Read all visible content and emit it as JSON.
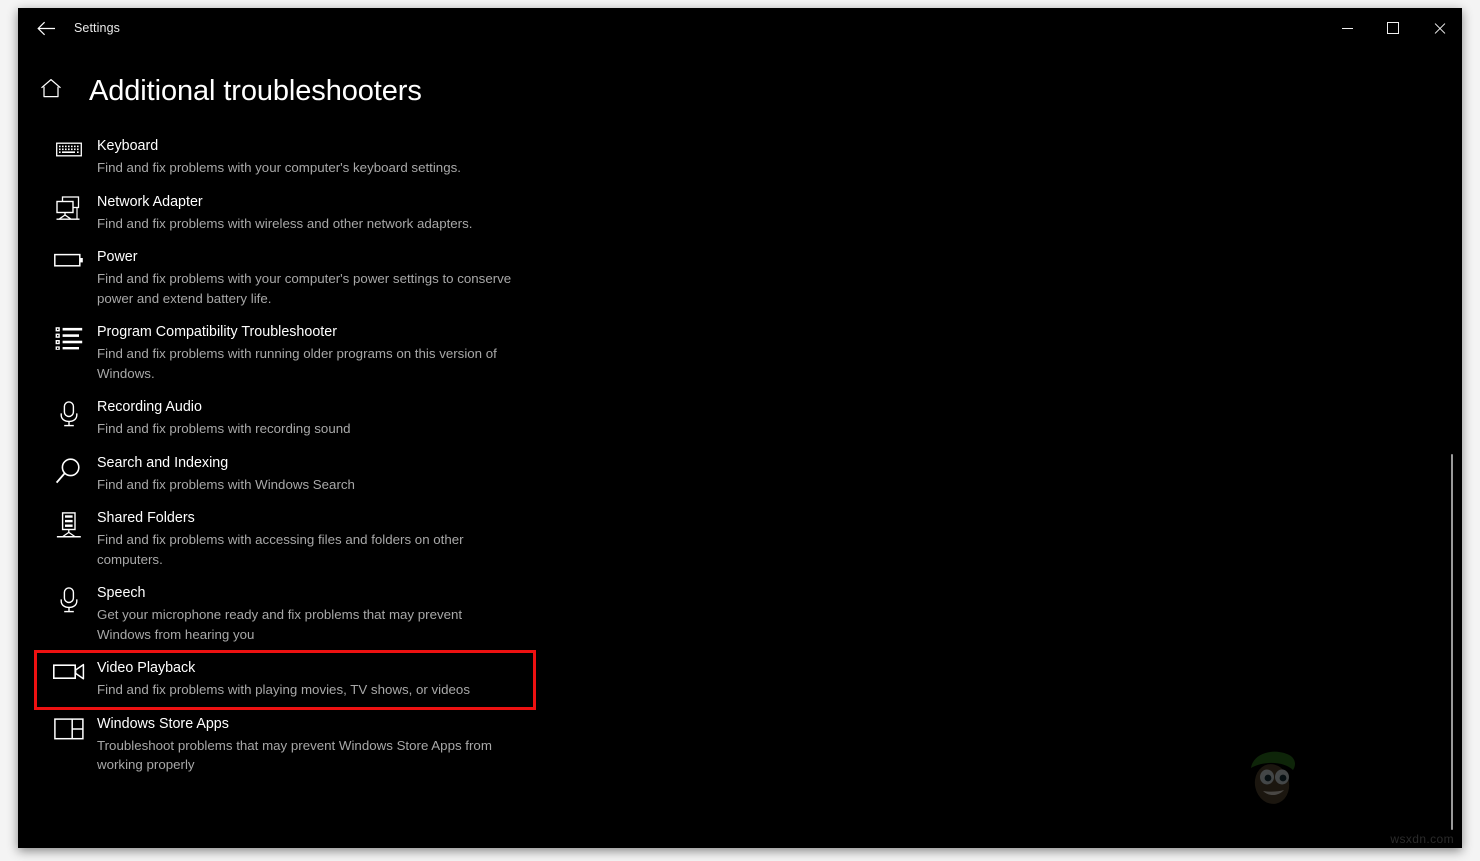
{
  "window": {
    "app_title": "Settings",
    "back_icon": "back-arrow-icon",
    "minimize_label": "Minimize",
    "maximize_label": "Maximize",
    "close_label": "Close"
  },
  "header": {
    "home_icon": "home-icon",
    "title": "Additional troubleshooters"
  },
  "troubleshooters": [
    {
      "icon": "keyboard-icon",
      "title": "Keyboard",
      "description": "Find and fix problems with your computer's keyboard settings.",
      "highlighted": false
    },
    {
      "icon": "network-adapter-icon",
      "title": "Network Adapter",
      "description": "Find and fix problems with wireless and other network adapters.",
      "highlighted": false
    },
    {
      "icon": "battery-icon",
      "title": "Power",
      "description": "Find and fix problems with your computer's power settings to conserve power and extend battery life.",
      "highlighted": false
    },
    {
      "icon": "list-icon",
      "title": "Program Compatibility Troubleshooter",
      "description": "Find and fix problems with running older programs on this version of Windows.",
      "highlighted": false
    },
    {
      "icon": "microphone-icon",
      "title": "Recording Audio",
      "description": "Find and fix problems with recording sound",
      "highlighted": false
    },
    {
      "icon": "search-icon",
      "title": "Search and Indexing",
      "description": "Find and fix problems with Windows Search",
      "highlighted": false
    },
    {
      "icon": "shared-folders-icon",
      "title": "Shared Folders",
      "description": "Find and fix problems with accessing files and folders on other computers.",
      "highlighted": false
    },
    {
      "icon": "microphone-icon",
      "title": "Speech",
      "description": "Get your microphone ready and fix problems that may prevent Windows from hearing you",
      "highlighted": false
    },
    {
      "icon": "video-camera-icon",
      "title": "Video Playback",
      "description": "Find and fix problems with playing movies, TV shows, or videos",
      "highlighted": true
    },
    {
      "icon": "store-apps-icon",
      "title": "Windows Store Apps",
      "description": "Troubleshoot problems that may prevent Windows Store Apps from working properly",
      "highlighted": false
    }
  ],
  "watermark": {
    "text": "wsxdn.com"
  },
  "colors": {
    "background": "#000000",
    "title_text": "#ffffff",
    "description_text": "#a8a8a8",
    "highlight_outline": "#ee1111",
    "page_background": "#f4f4f4"
  }
}
